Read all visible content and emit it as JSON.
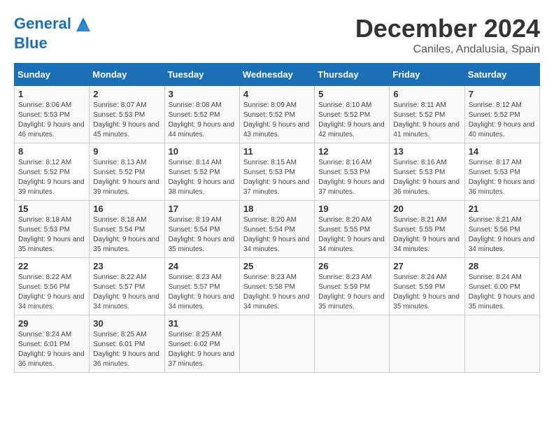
{
  "logo": {
    "line1": "General",
    "line2": "Blue"
  },
  "title": "December 2024",
  "location": "Caniles, Andalusia, Spain",
  "days_of_week": [
    "Sunday",
    "Monday",
    "Tuesday",
    "Wednesday",
    "Thursday",
    "Friday",
    "Saturday"
  ],
  "weeks": [
    [
      {
        "day": "1",
        "sunrise": "8:06 AM",
        "sunset": "5:53 PM",
        "daylight": "9 hours and 46 minutes."
      },
      {
        "day": "2",
        "sunrise": "8:07 AM",
        "sunset": "5:53 PM",
        "daylight": "9 hours and 45 minutes."
      },
      {
        "day": "3",
        "sunrise": "8:08 AM",
        "sunset": "5:52 PM",
        "daylight": "9 hours and 44 minutes."
      },
      {
        "day": "4",
        "sunrise": "8:09 AM",
        "sunset": "5:52 PM",
        "daylight": "9 hours and 43 minutes."
      },
      {
        "day": "5",
        "sunrise": "8:10 AM",
        "sunset": "5:52 PM",
        "daylight": "9 hours and 42 minutes."
      },
      {
        "day": "6",
        "sunrise": "8:11 AM",
        "sunset": "5:52 PM",
        "daylight": "9 hours and 41 minutes."
      },
      {
        "day": "7",
        "sunrise": "8:12 AM",
        "sunset": "5:52 PM",
        "daylight": "9 hours and 40 minutes."
      }
    ],
    [
      {
        "day": "8",
        "sunrise": "8:12 AM",
        "sunset": "5:52 PM",
        "daylight": "9 hours and 39 minutes."
      },
      {
        "day": "9",
        "sunrise": "8:13 AM",
        "sunset": "5:52 PM",
        "daylight": "9 hours and 39 minutes."
      },
      {
        "day": "10",
        "sunrise": "8:14 AM",
        "sunset": "5:52 PM",
        "daylight": "9 hours and 38 minutes."
      },
      {
        "day": "11",
        "sunrise": "8:15 AM",
        "sunset": "5:53 PM",
        "daylight": "9 hours and 37 minutes."
      },
      {
        "day": "12",
        "sunrise": "8:16 AM",
        "sunset": "5:53 PM",
        "daylight": "9 hours and 37 minutes."
      },
      {
        "day": "13",
        "sunrise": "8:16 AM",
        "sunset": "5:53 PM",
        "daylight": "9 hours and 36 minutes."
      },
      {
        "day": "14",
        "sunrise": "8:17 AM",
        "sunset": "5:53 PM",
        "daylight": "9 hours and 36 minutes."
      }
    ],
    [
      {
        "day": "15",
        "sunrise": "8:18 AM",
        "sunset": "5:53 PM",
        "daylight": "9 hours and 35 minutes."
      },
      {
        "day": "16",
        "sunrise": "8:18 AM",
        "sunset": "5:54 PM",
        "daylight": "9 hours and 35 minutes."
      },
      {
        "day": "17",
        "sunrise": "8:19 AM",
        "sunset": "5:54 PM",
        "daylight": "9 hours and 35 minutes."
      },
      {
        "day": "18",
        "sunrise": "8:20 AM",
        "sunset": "5:54 PM",
        "daylight": "9 hours and 34 minutes."
      },
      {
        "day": "19",
        "sunrise": "8:20 AM",
        "sunset": "5:55 PM",
        "daylight": "9 hours and 34 minutes."
      },
      {
        "day": "20",
        "sunrise": "8:21 AM",
        "sunset": "5:55 PM",
        "daylight": "9 hours and 34 minutes."
      },
      {
        "day": "21",
        "sunrise": "8:21 AM",
        "sunset": "5:56 PM",
        "daylight": "9 hours and 34 minutes."
      }
    ],
    [
      {
        "day": "22",
        "sunrise": "8:22 AM",
        "sunset": "5:56 PM",
        "daylight": "9 hours and 34 minutes."
      },
      {
        "day": "23",
        "sunrise": "8:22 AM",
        "sunset": "5:57 PM",
        "daylight": "9 hours and 34 minutes."
      },
      {
        "day": "24",
        "sunrise": "8:23 AM",
        "sunset": "5:57 PM",
        "daylight": "9 hours and 34 minutes."
      },
      {
        "day": "25",
        "sunrise": "8:23 AM",
        "sunset": "5:58 PM",
        "daylight": "9 hours and 34 minutes."
      },
      {
        "day": "26",
        "sunrise": "8:23 AM",
        "sunset": "5:59 PM",
        "daylight": "9 hours and 35 minutes."
      },
      {
        "day": "27",
        "sunrise": "8:24 AM",
        "sunset": "5:59 PM",
        "daylight": "9 hours and 35 minutes."
      },
      {
        "day": "28",
        "sunrise": "8:24 AM",
        "sunset": "6:00 PM",
        "daylight": "9 hours and 35 minutes."
      }
    ],
    [
      {
        "day": "29",
        "sunrise": "8:24 AM",
        "sunset": "6:01 PM",
        "daylight": "9 hours and 36 minutes."
      },
      {
        "day": "30",
        "sunrise": "8:25 AM",
        "sunset": "6:01 PM",
        "daylight": "9 hours and 36 minutes."
      },
      {
        "day": "31",
        "sunrise": "8:25 AM",
        "sunset": "6:02 PM",
        "daylight": "9 hours and 37 minutes."
      },
      null,
      null,
      null,
      null
    ]
  ]
}
